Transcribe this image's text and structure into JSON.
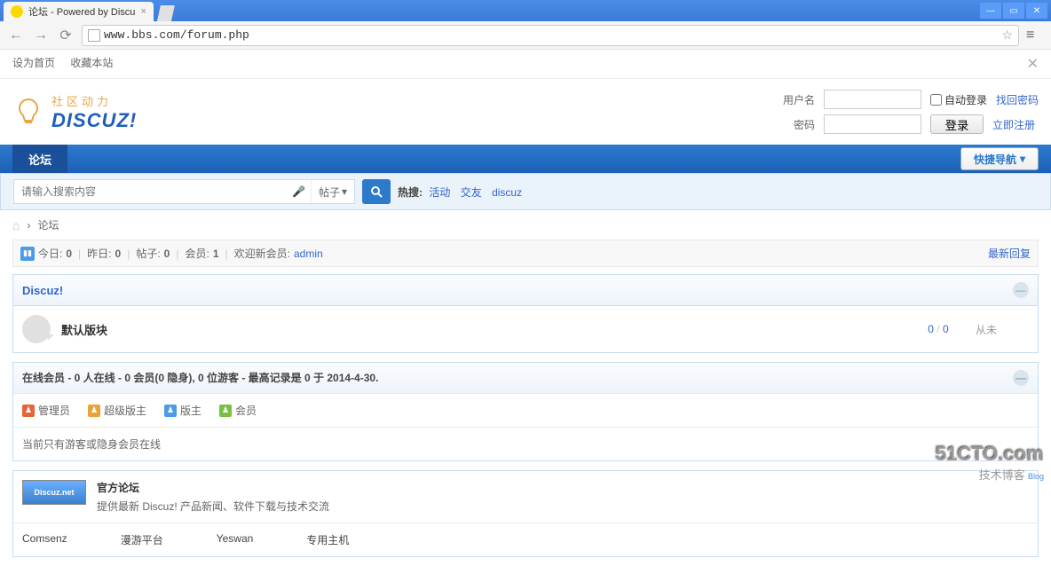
{
  "browser": {
    "tab_title": "论坛 - Powered by Discu",
    "url": "www.bbs.com/forum.php"
  },
  "top_links": {
    "set_home": "设为首页",
    "favorite": "收藏本站"
  },
  "logo": {
    "cn": "社区动力",
    "en": "DISCUZ!"
  },
  "login": {
    "username_label": "用户名",
    "password_label": "密码",
    "auto_login": "自动登录",
    "login_btn": "登录",
    "find_pwd": "找回密码",
    "register": "立即注册"
  },
  "nav": {
    "forum": "论坛",
    "quick": "快捷导航"
  },
  "search": {
    "placeholder": "请输入搜索内容",
    "type": "帖子",
    "hot_label": "热搜:",
    "hot_items": [
      "活动",
      "交友",
      "discuz"
    ]
  },
  "breadcrumb": {
    "forum": "论坛"
  },
  "stats": {
    "today_label": "今日:",
    "today": "0",
    "yesterday_label": "昨日:",
    "yesterday": "0",
    "posts_label": "帖子:",
    "posts": "0",
    "members_label": "会员:",
    "members": "1",
    "welcome": "欢迎新会员:",
    "new_member": "admin",
    "latest_reply": "最新回复"
  },
  "category": {
    "title": "Discuz!",
    "forums": [
      {
        "name": "默认版块",
        "threads": "0",
        "posts": "0",
        "last": "从未"
      }
    ]
  },
  "online": {
    "header": "在线会员 - 0 人在线 - 0 会员(0 隐身), 0 位游客 - 最高记录是 0 于 2014-4-30.",
    "legend": [
      {
        "label": "管理员",
        "color": "#e8623a"
      },
      {
        "label": "超级版主",
        "color": "#e8a23a"
      },
      {
        "label": "版主",
        "color": "#4a9be8"
      },
      {
        "label": "会员",
        "color": "#7ac040"
      }
    ],
    "message": "当前只有游客或隐身会员在线"
  },
  "official": {
    "logo_text": "Discuz.net",
    "name": "官方论坛",
    "desc": "提供最新 Discuz! 产品新闻、软件下载与技术交流"
  },
  "footer_links": [
    "Comsenz",
    "漫游平台",
    "Yeswan",
    "专用主机"
  ],
  "watermark": {
    "big": "51CTO.com",
    "small": "技术博客",
    "blog": "Blog"
  }
}
